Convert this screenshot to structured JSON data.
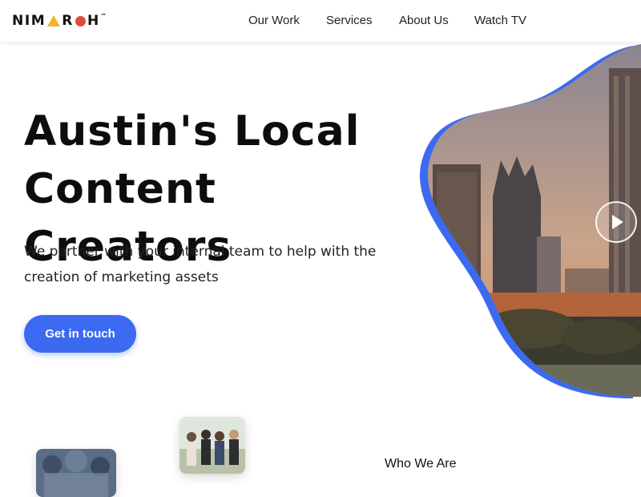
{
  "header": {
    "logo_text": "NIMAROH",
    "logo_trademark": "™",
    "nav": [
      {
        "label": "Our Work"
      },
      {
        "label": "Services"
      },
      {
        "label": "About Us"
      },
      {
        "label": "Watch TV"
      }
    ]
  },
  "hero": {
    "title_line1": "Austin's Local",
    "title_line2": "Content Creators",
    "subtitle": "We partner with your internal team to help with the creation of marketing assets",
    "cta_label": "Get in touch",
    "video_play_icon": "play-icon"
  },
  "colors": {
    "accent_blue": "#3b6af0",
    "logo_yellow": "#f0b429",
    "logo_red": "#e04b3c"
  },
  "section": {
    "who_we_are": "Who We Are"
  }
}
